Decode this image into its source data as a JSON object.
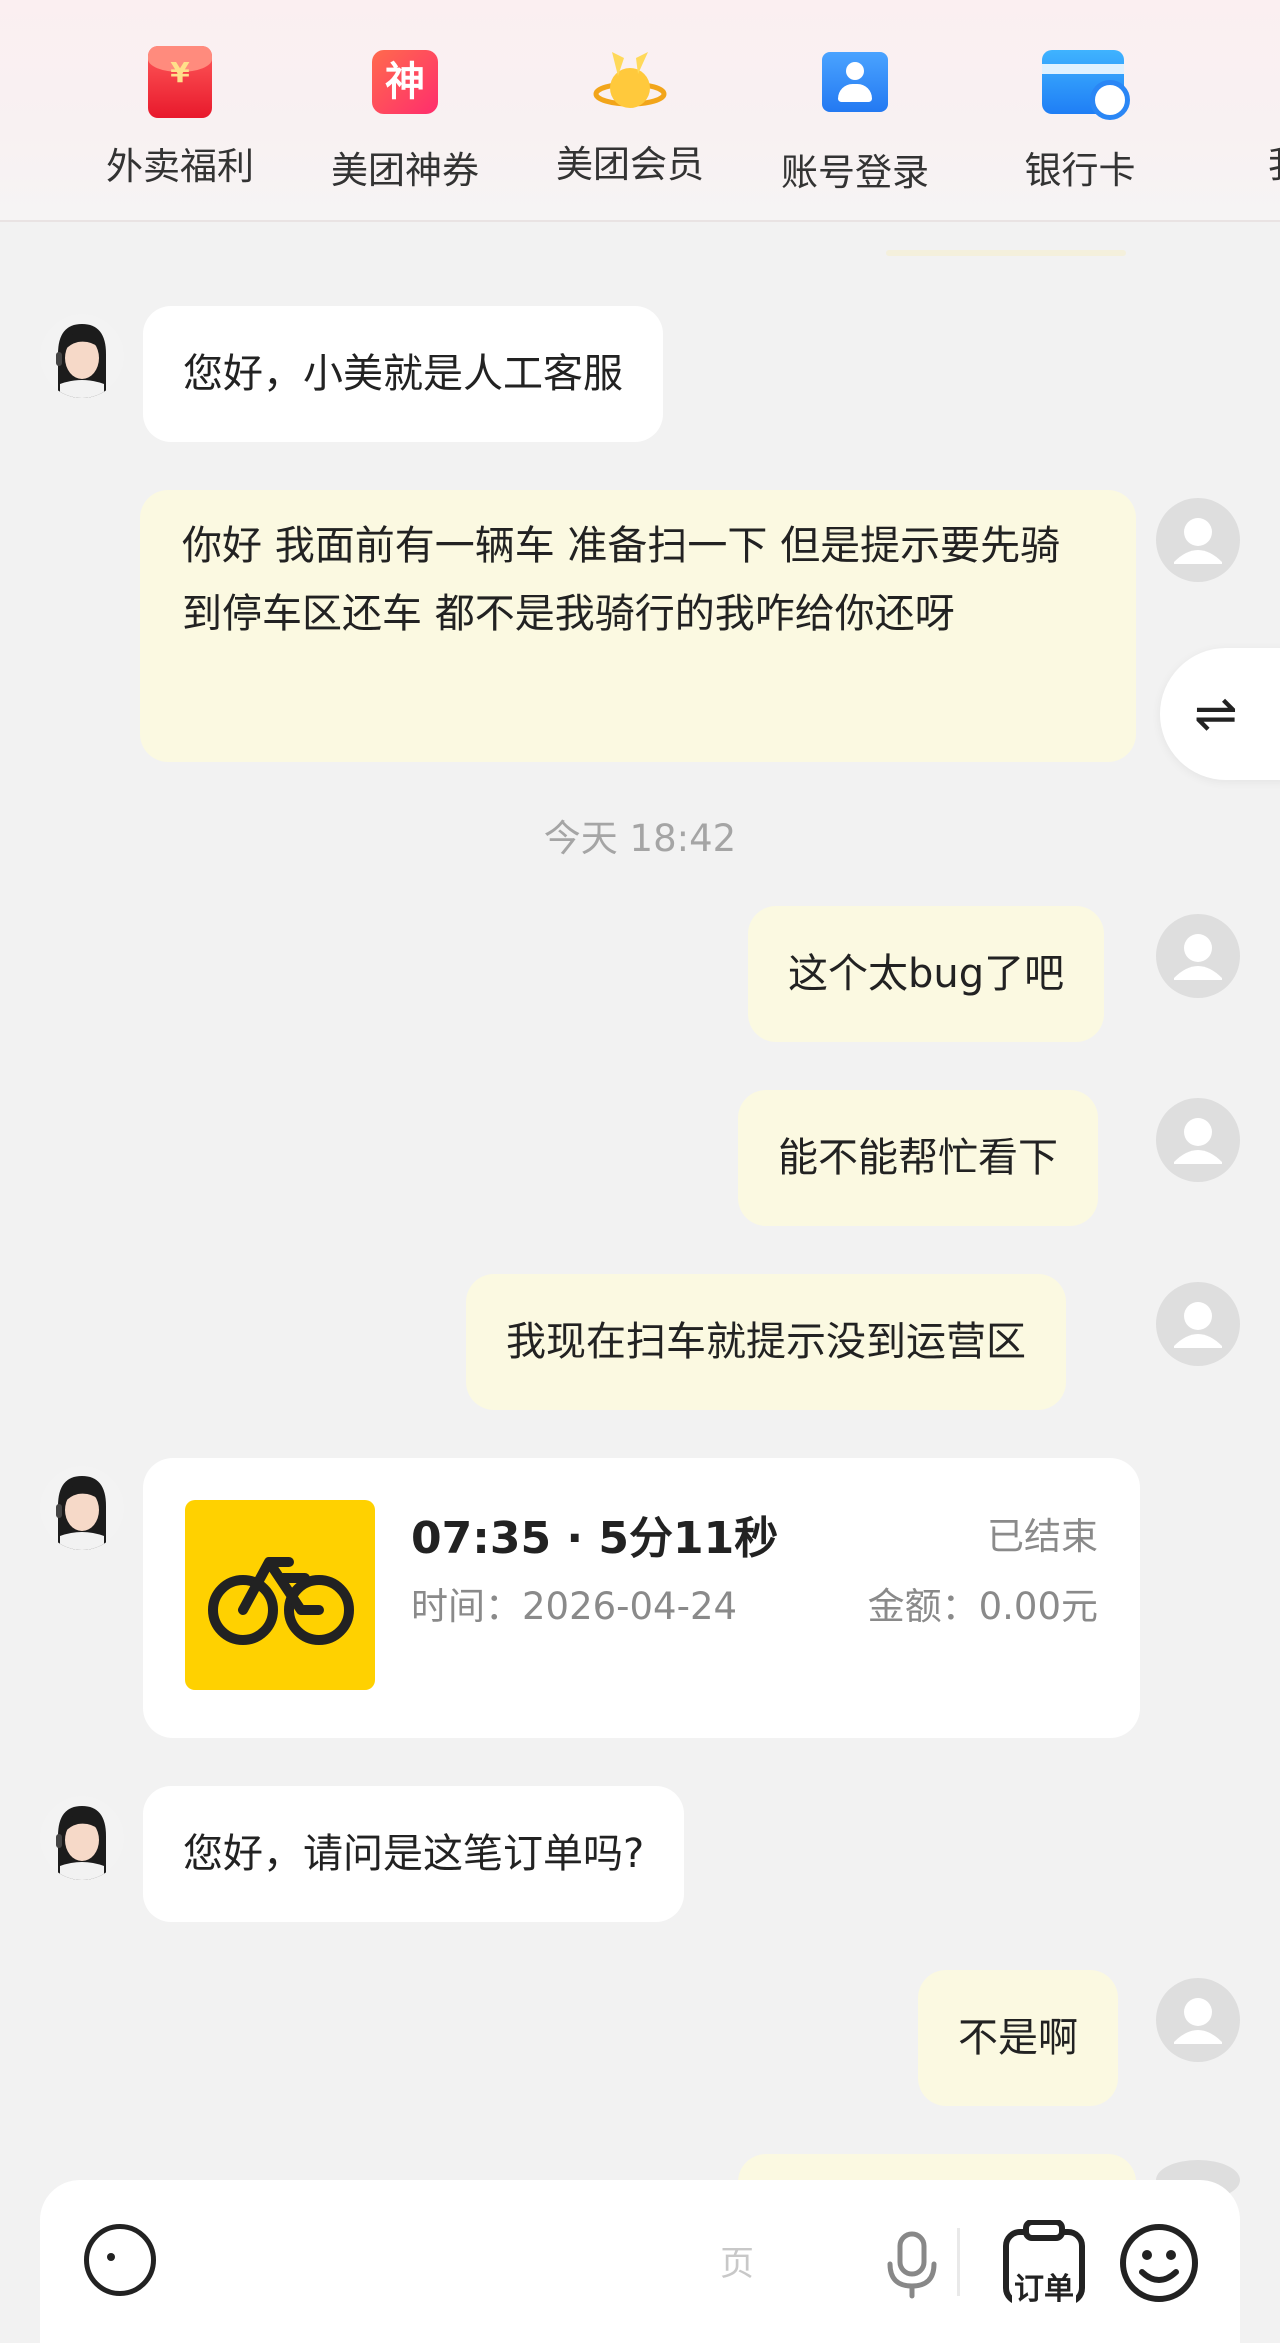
{
  "quick_services": [
    {
      "label": "外卖福利",
      "icon": "red-envelope-icon"
    },
    {
      "label": "美团神券",
      "icon": "coupon-icon"
    },
    {
      "label": "美团会员",
      "icon": "member-icon"
    },
    {
      "label": "账号登录",
      "icon": "account-login-icon"
    },
    {
      "label": "银行卡",
      "icon": "bank-card-icon"
    },
    {
      "label": "我要",
      "icon": "more-icon"
    }
  ],
  "chat": {
    "agent_greeting": "您好，小美就是人工客服",
    "user_msg_1": "你好 我面前有一辆车 准备扫一下 但是提示要先骑到停车区还车 都不是我骑行的我咋给你还呀",
    "timestamp": "今天 18:42",
    "user_msg_2": "这个太bug了吧",
    "user_msg_3": "能不能帮忙看下",
    "user_msg_4": "我现在扫车就提示没到运营区",
    "order": {
      "title": "07:35 · 5分11秒",
      "status": "已结束",
      "time": "时间：2026-04-24",
      "amount": "金额：0.00元"
    },
    "agent_question": "您好，请问是这笔订单吗?",
    "user_msg_5": "不是啊"
  },
  "switch_button": "⇌",
  "input_bar": {
    "placeholder": "页",
    "order_label": "订单"
  },
  "colors": {
    "user_bubble": "#fbf9e1",
    "agent_bubble": "#ffffff",
    "bike_thumb": "#ffd100",
    "background": "#f2f2f2"
  }
}
